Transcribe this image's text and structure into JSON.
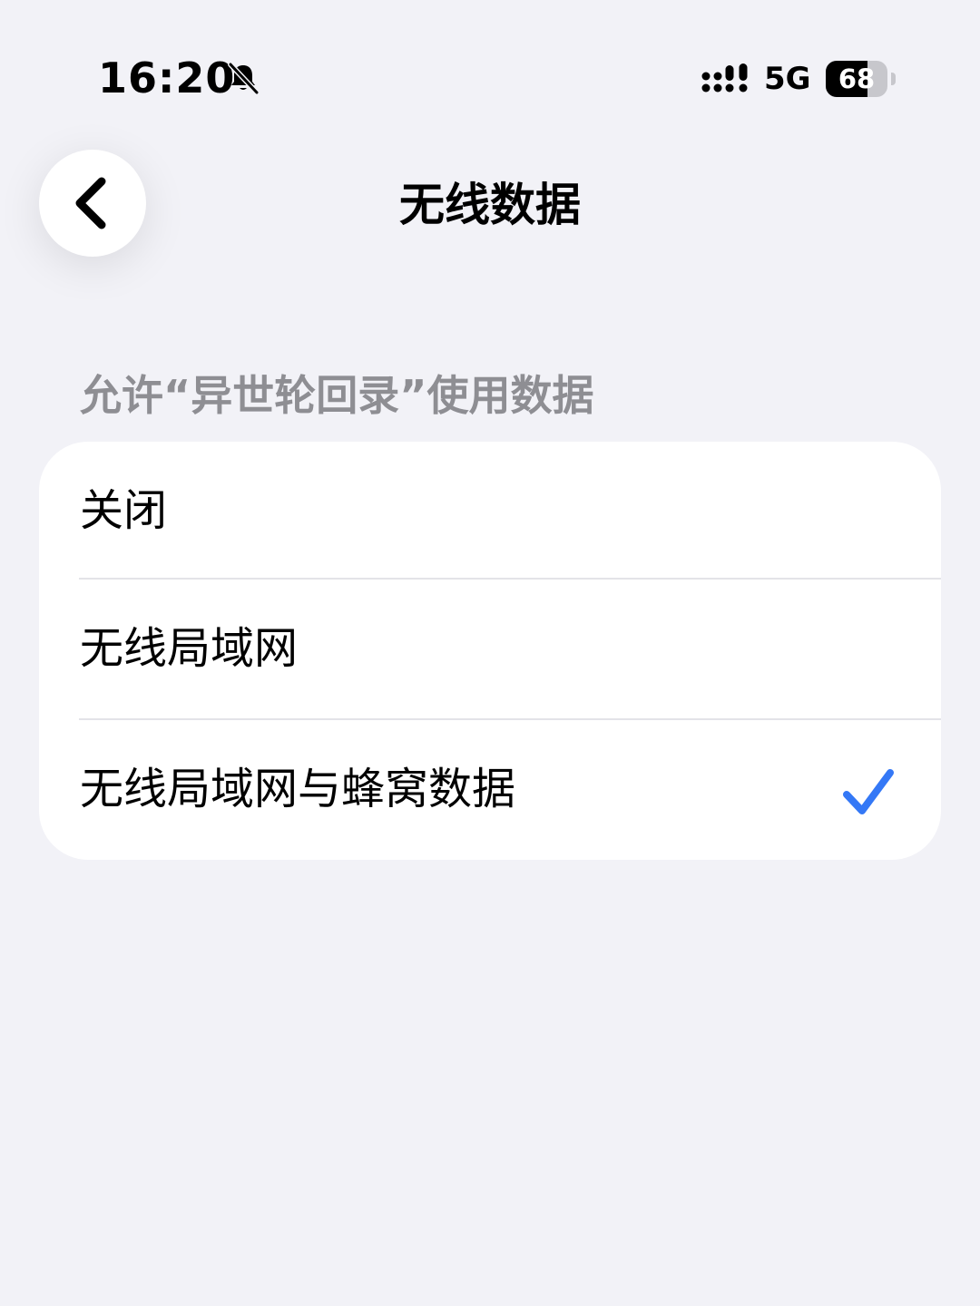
{
  "status_bar": {
    "time": "16:20",
    "network": "5G",
    "battery_percent": "68",
    "battery_level": 0.68,
    "icons": [
      "bell-slash-icon",
      "signal-icon"
    ]
  },
  "nav": {
    "title": "无线数据",
    "back_icon": "chevron-left-icon"
  },
  "section": {
    "header": "允许“异世轮回录”使用数据",
    "options": [
      {
        "label": "关闭",
        "selected": false
      },
      {
        "label": "无线局域网",
        "selected": false
      },
      {
        "label": "无线局域网与蜂窝数据",
        "selected": true
      }
    ]
  },
  "colors": {
    "background": "#f2f2f7",
    "card": "#ffffff",
    "secondary_text": "#8e8e93",
    "accent": "#3478f6",
    "divider": "#e3e3e8"
  }
}
